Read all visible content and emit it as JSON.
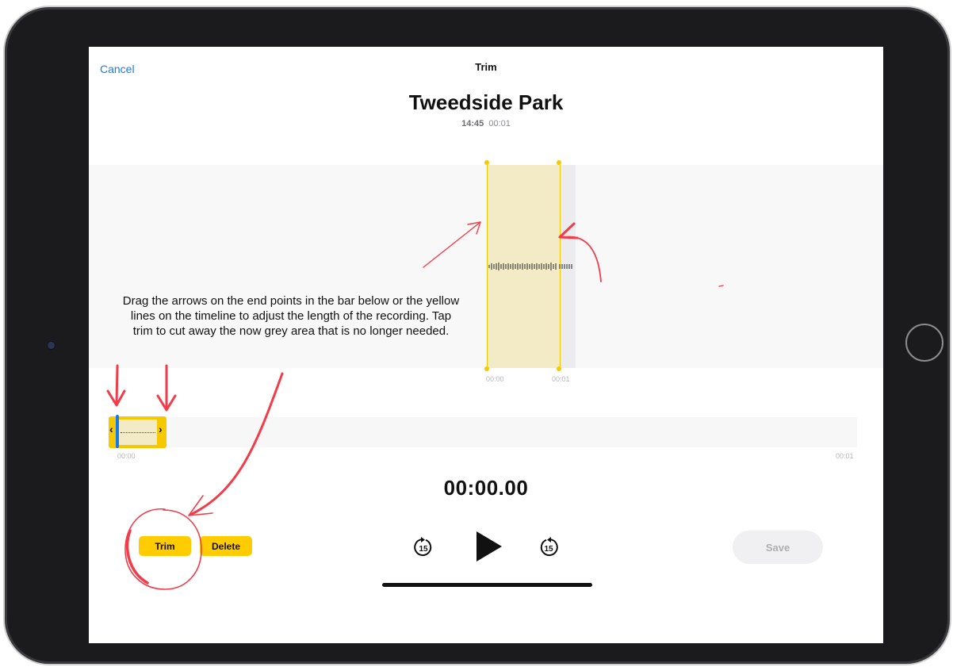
{
  "nav": {
    "cancel_label": "Cancel",
    "title": "Trim"
  },
  "recording": {
    "title": "Tweedside Park",
    "time": "14:45",
    "duration": "00:01"
  },
  "waveform": {
    "tick_start": "00:00",
    "tick_end": "00:01"
  },
  "instruction": "Drag the arrows on the end points in the bar below or the yellow lines on the timeline to adjust the length of the recording. Tap trim to cut away the now grey area that is no longer needed.",
  "timeline": {
    "start_label": "00:00",
    "end_label": "00:01",
    "left_arrow": "‹",
    "right_arrow": "›"
  },
  "playback": {
    "current_time": "00:00.00",
    "skip_back_label": "15",
    "skip_forward_label": "15"
  },
  "buttons": {
    "trim_label": "Trim",
    "delete_label": "Delete",
    "save_label": "Save"
  },
  "colors": {
    "accent_yellow": "#ffcc00",
    "link_blue": "#1a7af0",
    "annotation_red": "#f23c4a",
    "playhead_blue": "#1677e6"
  },
  "icons": {
    "skip_back": "gobackward-15-icon",
    "play": "play-icon",
    "skip_forward": "goforward-15-icon"
  }
}
